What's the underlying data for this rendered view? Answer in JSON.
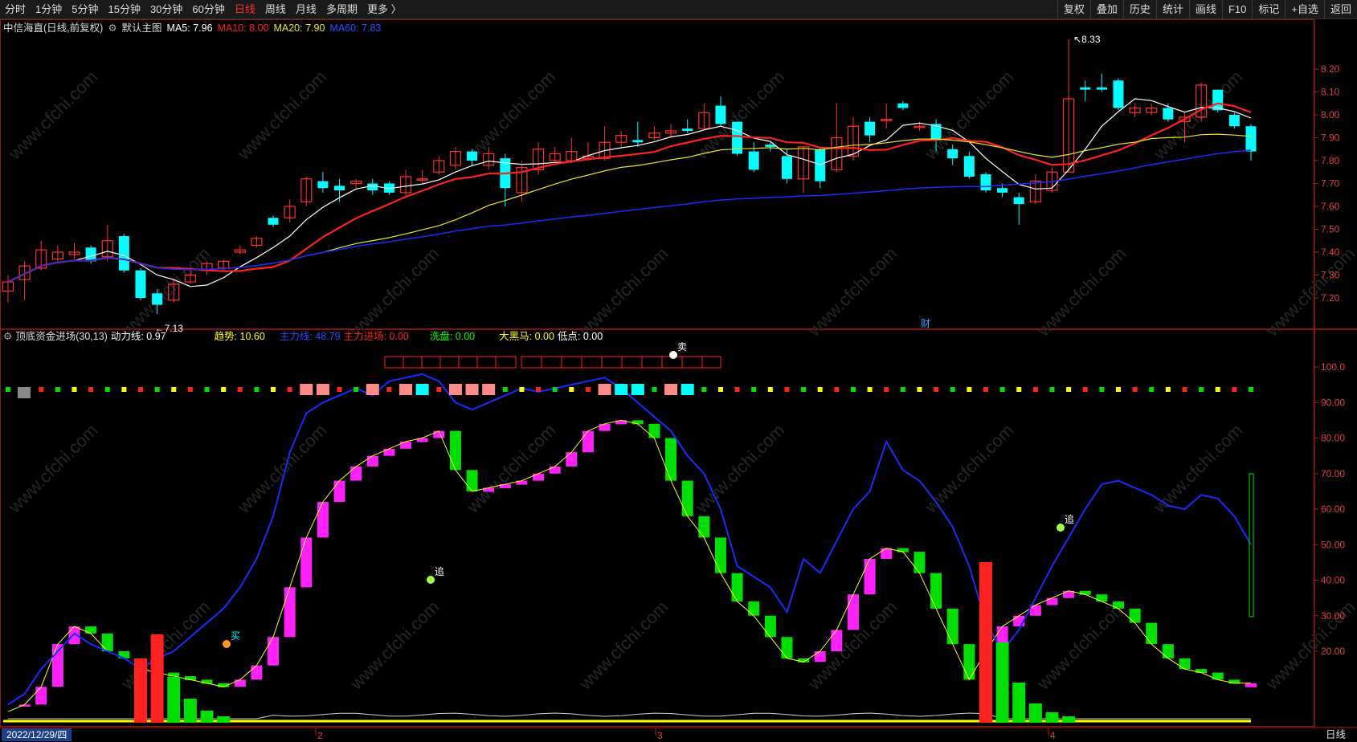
{
  "toolbar": {
    "periods": [
      "分时",
      "1分钟",
      "5分钟",
      "15分钟",
      "30分钟",
      "60分钟",
      "日线",
      "周线",
      "月线",
      "多周期",
      "更多 〉"
    ],
    "active_period": "日线",
    "tools": [
      "复权",
      "叠加",
      "历史",
      "统计",
      "画线",
      "F10",
      "标记",
      "+自选",
      "返回"
    ]
  },
  "main_chart": {
    "stock_title": "中信海直(日线,前复权)",
    "template": "默认主图",
    "ma5_label": "MA5: 7.96",
    "ma10_label": "MA10: 8.00",
    "ma20_label": "MA20: 7.90",
    "ma60_label": "MA60: 7.83",
    "price_ticks": [
      "8.20",
      "8.10",
      "8.00",
      "7.90",
      "7.80",
      "7.70",
      "7.60",
      "7.50",
      "7.40",
      "7.30",
      "7.20"
    ],
    "high_marker": "8.33",
    "low_marker": "7.13",
    "finance_marker": "财",
    "colors": {
      "ma5": "#ffffff",
      "ma10": "#ff2020",
      "ma20": "#e8e820",
      "ma60": "#1a2aff",
      "up": "#ff3030",
      "down": "#00ffff"
    }
  },
  "indicator": {
    "name": "顶底资金进场(30,13)",
    "dongli": "动力线: 0.97",
    "qushi": "趋势: 10.60",
    "zhuli": "主力线: 48.79",
    "zhuli_jin": "主力进场: 0.00",
    "xipan": "洗盘: 0.00",
    "dahei": "大黑马: 0.00",
    "didian": "低点: 0.00",
    "ticks": [
      "100.0",
      "90.00",
      "80.00",
      "70.00",
      "60.00",
      "50.00",
      "40.00",
      "30.00",
      "20.00"
    ],
    "signals": [
      "买",
      "追",
      "追",
      "卖"
    ],
    "colors": {
      "qushi": "#ffff00",
      "zhuli": "#1a2aff",
      "zhuli_jin": "#ff2020",
      "xipan": "#00ff00",
      "dahei": "#ffff00",
      "didian": "#ffffff"
    }
  },
  "date_axis": {
    "start_date": "2022/12/29/四",
    "month_labels": [
      "2",
      "3",
      "4"
    ],
    "period": "日线"
  },
  "watermark": "www.cfchi.com"
}
